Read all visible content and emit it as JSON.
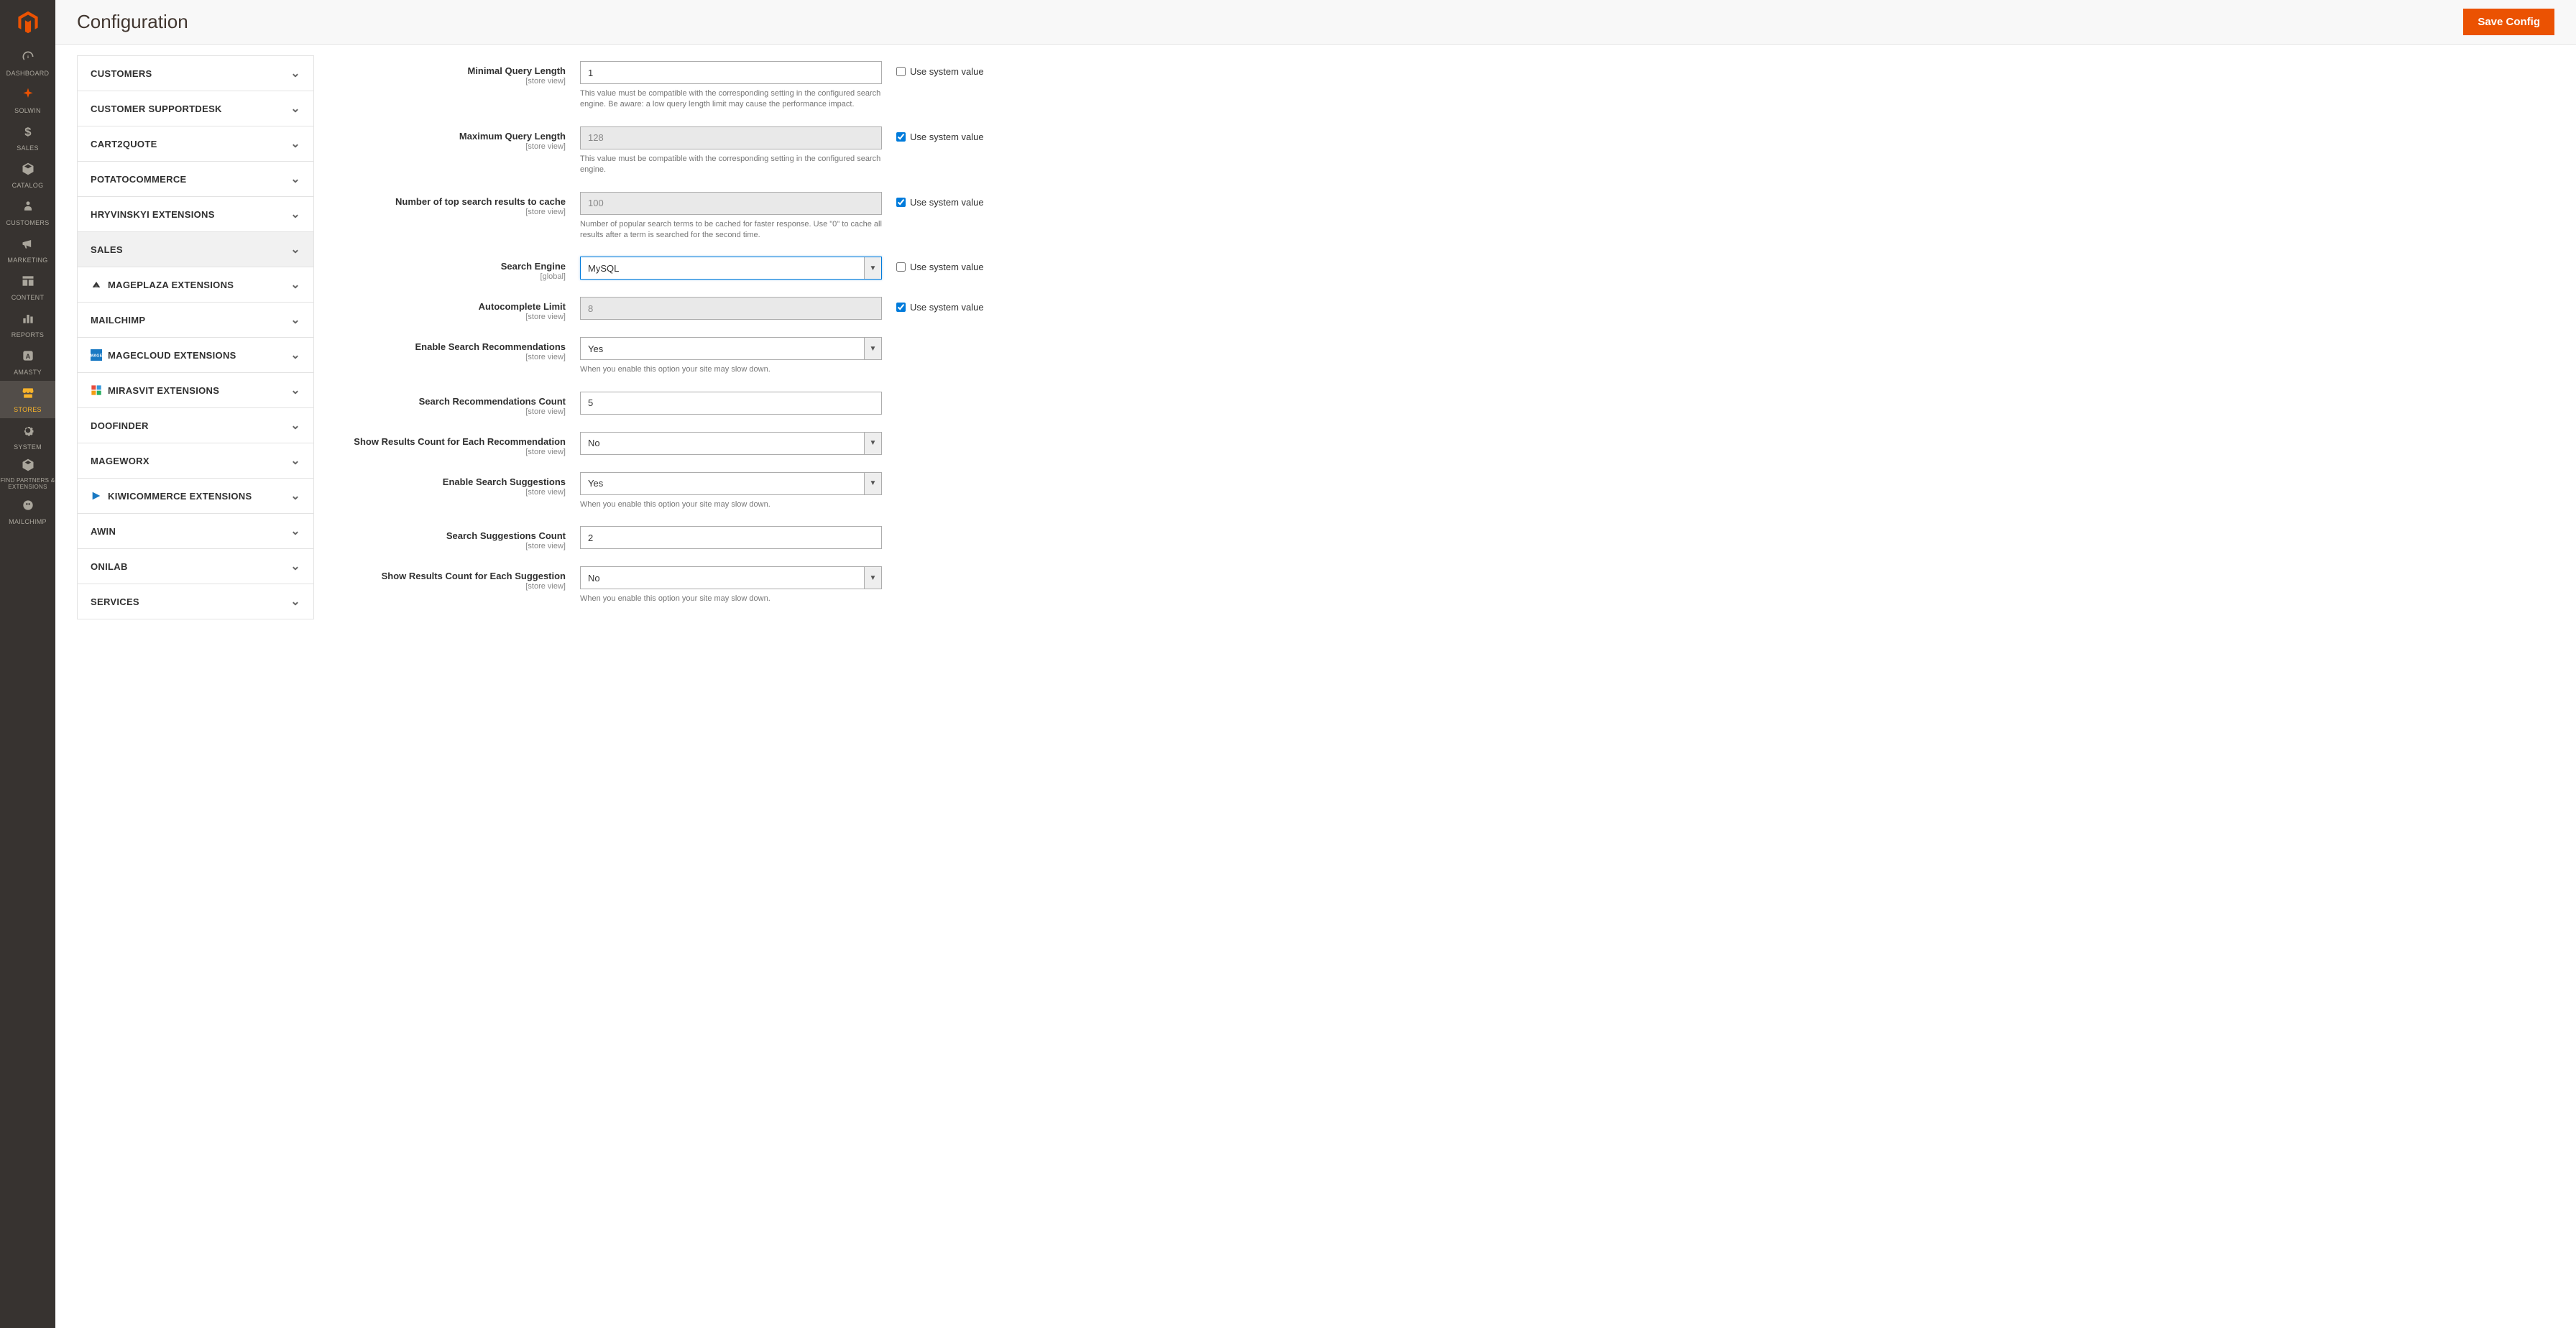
{
  "header": {
    "title": "Configuration",
    "save_button": "Save Config"
  },
  "admin_nav": [
    {
      "id": "dashboard",
      "label": "DASHBOARD",
      "icon": "gauge"
    },
    {
      "id": "solwin",
      "label": "SOLWIN",
      "icon": "compass"
    },
    {
      "id": "sales",
      "label": "SALES",
      "icon": "dollar"
    },
    {
      "id": "catalog",
      "label": "CATALOG",
      "icon": "box"
    },
    {
      "id": "customers",
      "label": "CUSTOMERS",
      "icon": "person"
    },
    {
      "id": "marketing",
      "label": "MARKETING",
      "icon": "megaphone"
    },
    {
      "id": "content",
      "label": "CONTENT",
      "icon": "layout"
    },
    {
      "id": "reports",
      "label": "REPORTS",
      "icon": "bars"
    },
    {
      "id": "amasty",
      "label": "AMASTY",
      "icon": "amasty"
    },
    {
      "id": "stores",
      "label": "STORES",
      "icon": "store",
      "active": true
    },
    {
      "id": "system",
      "label": "SYSTEM",
      "icon": "gear"
    },
    {
      "id": "find-partners",
      "label": "FIND PARTNERS & EXTENSIONS",
      "icon": "partners",
      "small": true
    },
    {
      "id": "mailchimp-nav",
      "label": "MAILCHIMP",
      "icon": "mailchimp"
    }
  ],
  "config_sections": [
    {
      "id": "customers",
      "label": "CUSTOMERS"
    },
    {
      "id": "customer-supportdesk",
      "label": "CUSTOMER SUPPORTDESK"
    },
    {
      "id": "cart2quote",
      "label": "CART2QUOTE"
    },
    {
      "id": "potatocommerce",
      "label": "POTATOCOMMERCE"
    },
    {
      "id": "hryvinskyi",
      "label": "HRYVINSKYI EXTENSIONS"
    },
    {
      "id": "sales",
      "label": "SALES",
      "active": true
    },
    {
      "id": "mageplaza",
      "label": "MAGEPLAZA EXTENSIONS",
      "icon": "mageplaza"
    },
    {
      "id": "mailchimp",
      "label": "MAILCHIMP"
    },
    {
      "id": "magecloud",
      "label": "MAGECLOUD EXTENSIONS",
      "icon": "magecloud"
    },
    {
      "id": "mirasvit",
      "label": "MIRASVIT EXTENSIONS",
      "icon": "mirasvit"
    },
    {
      "id": "doofinder",
      "label": "DOOFINDER"
    },
    {
      "id": "mageworx",
      "label": "MAGEWORX"
    },
    {
      "id": "kiwicommerce",
      "label": "KIWICOMMERCE EXTENSIONS",
      "icon": "kiwi"
    },
    {
      "id": "awin",
      "label": "AWIN"
    },
    {
      "id": "onilab",
      "label": "ONILAB"
    },
    {
      "id": "services",
      "label": "SERVICES"
    }
  ],
  "form": {
    "use_system_value_label": "Use system value",
    "fields": {
      "min_query_length": {
        "label": "Minimal Query Length",
        "scope": "[store view]",
        "value": "1",
        "help": "This value must be compatible with the corresponding setting in the configured search engine. Be aware: a low query length limit may cause the performance impact.",
        "use_system": false
      },
      "max_query_length": {
        "label": "Maximum Query Length",
        "scope": "[store view]",
        "value": "128",
        "help": "This value must be compatible with the corresponding setting in the configured search engine.",
        "use_system": true,
        "disabled": true
      },
      "top_results_cache": {
        "label": "Number of top search results to cache",
        "scope": "[store view]",
        "value": "100",
        "help": "Number of popular search terms to be cached for faster response. Use \"0\" to cache all results after a term is searched for the second time.",
        "use_system": true,
        "disabled": true
      },
      "search_engine": {
        "label": "Search Engine",
        "scope": "[global]",
        "value": "MySQL",
        "type": "select",
        "use_system": false,
        "highlighted": true
      },
      "autocomplete_limit": {
        "label": "Autocomplete Limit",
        "scope": "[store view]",
        "value": "8",
        "use_system": true,
        "disabled": true
      },
      "enable_recommendations": {
        "label": "Enable Search Recommendations",
        "scope": "[store view]",
        "value": "Yes",
        "type": "select",
        "help": "When you enable this option your site may slow down."
      },
      "recommendations_count": {
        "label": "Search Recommendations Count",
        "scope": "[store view]",
        "value": "5"
      },
      "show_results_each_recommendation": {
        "label": "Show Results Count for Each Recommendation",
        "scope": "[store view]",
        "value": "No",
        "type": "select"
      },
      "enable_suggestions": {
        "label": "Enable Search Suggestions",
        "scope": "[store view]",
        "value": "Yes",
        "type": "select",
        "help": "When you enable this option your site may slow down."
      },
      "suggestions_count": {
        "label": "Search Suggestions Count",
        "scope": "[store view]",
        "value": "2"
      },
      "show_results_each_suggestion": {
        "label": "Show Results Count for Each Suggestion",
        "scope": "[store view]",
        "value": "No",
        "type": "select",
        "help": "When you enable this option your site may slow down."
      }
    }
  }
}
